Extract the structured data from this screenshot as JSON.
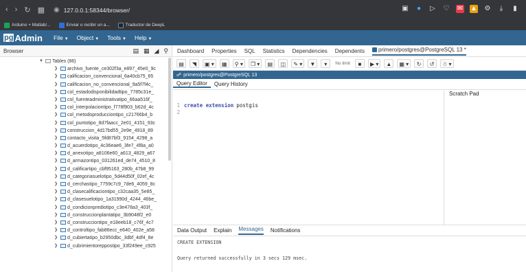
{
  "browser": {
    "url": "127.0.0.1:58344/browser/",
    "bookmarks": [
      "Arduino + Matlab/...",
      "Enviar o recibir un a...",
      "Traductor de DeepL"
    ]
  },
  "app": {
    "logo_pg": "pg",
    "logo_rest": "Admin",
    "menus": [
      "File",
      "Object",
      "Tools",
      "Help"
    ]
  },
  "left_panel": {
    "title": "Browser",
    "tables_node": "Tables (86)",
    "items": [
      "archivo_fuente_ce302f3a_e897_45e0_9c",
      "calificacion_convencional_6a40cb75_65",
      "calificacion_no_convencional_9a5f7f4c_",
      "col_estadodisponibilidadtipo_7785c31e_",
      "col_fuenteadministrativatipo_66aa516f_",
      "col_interpolaciontipo_f778f903_b62d_4c",
      "col_metodoproducciontipo_c21766b4_b",
      "col_puntotipo_8d7faacc_2e01_4151_93c",
      "construccion_4d17bd55_2e9e_4918_89",
      "contacto_visita_5fd87bf3_9154_4298_a",
      "d_acuerdotipo_4c36eae6_3fe7_4f8a_a0",
      "d_anexotipo_a8106e60_a613_4829_a67",
      "d_armazontipo_031261ed_de74_4510_8",
      "d_calificartipo_cbf95163_280b_47b8_99",
      "d_categoriasuelotipo_5d44d50f_02ef_4c",
      "d_cerchastipo_7759c7c9_7de6_4059_8c",
      "d_clasecalificaciontipo_c32caa35_5e85_",
      "d_clasesuelotipo_1a31990d_4244_46be_",
      "d_condicionprediotipo_c3e478a3_403f_",
      "d_construccionplantatipo_3b9048f2_e0",
      "d_construcciontipo_e18eeb18_c76f_4c7",
      "d_controltipo_fab86ecc_e640_402e_a58",
      "d_cubiertatipo_b2950dbc_3dbf_4df4_8e",
      "d_cubrimientoreppostipo_33f249ee_c925"
    ]
  },
  "right_panel": {
    "tabs": [
      "Dashboard",
      "Properties",
      "SQL",
      "Statistics",
      "Dependencies",
      "Dependents"
    ],
    "query_tab": "primero/postgres@PostgreSQL 13 *",
    "toolbar_nolimit": "No limit",
    "connection": "primero/postgres@PostgreSQL 13",
    "editor_tabs": [
      "Query Editor",
      "Query History"
    ],
    "scratch_pad": "Scratch Pad",
    "code": {
      "line1": "1",
      "line2": "2",
      "keyword": "create extension",
      "identifier": "postgis"
    },
    "bottom_tabs": [
      "Data Output",
      "Explain",
      "Messages",
      "Notifications"
    ],
    "messages": {
      "line1": "CREATE EXTENSION",
      "line2": "Query returned successfully in 3 secs 129 msec."
    }
  },
  "colors": {
    "brand": "#326690",
    "chrome": "#35363a"
  }
}
